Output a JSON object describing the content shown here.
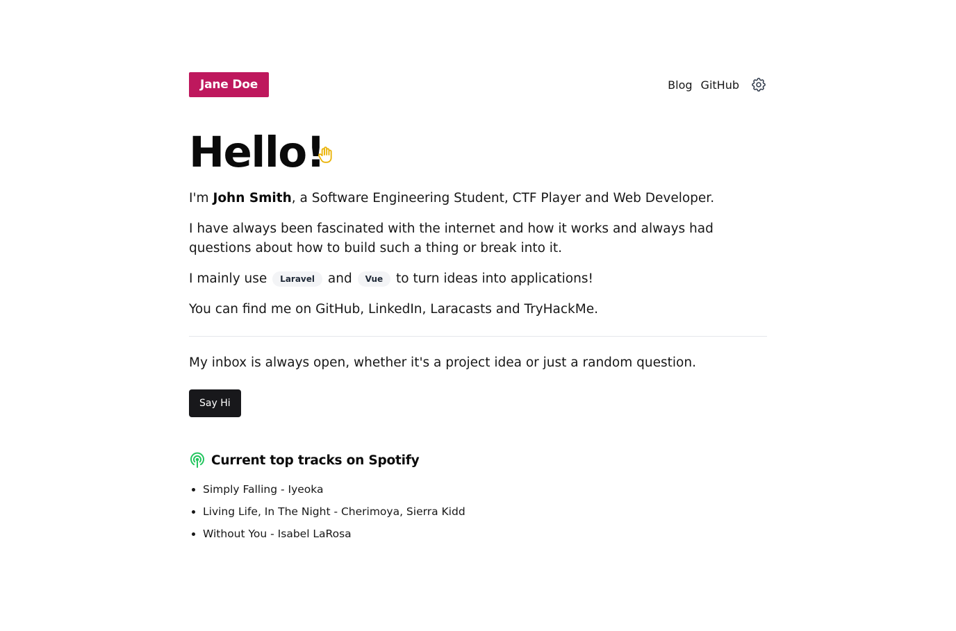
{
  "header": {
    "brand": "Jane Doe",
    "nav": [
      "Blog",
      "GitHub"
    ],
    "settings_icon": "gear-icon"
  },
  "hero": {
    "title": "Hello!",
    "wave_icon": "waving-hand-icon"
  },
  "intro": {
    "prefix": "I'm ",
    "name": "John Smith",
    "suffix": ", a Software Engineering Student, CTF Player and Web Developer.",
    "fascination": "I have always been fascinated with the internet and how it works and always had questions about how to build such a thing or break into it.",
    "tools_prefix": "I mainly use",
    "tool_1": "Laravel",
    "tools_and": "and",
    "tool_2": "Vue",
    "tools_suffix": "to turn ideas into applications!",
    "find_prefix": "You can find me on ",
    "link_github": "GitHub",
    "link_linkedin": "LinkedIn",
    "link_laracasts": "Laracasts",
    "find_and": " and ",
    "link_tryhackme": "TryHackMe",
    "find_suffix": "."
  },
  "contact": {
    "text": "My inbox is always open, whether it's a project idea or just a random question.",
    "button": "Say Hi"
  },
  "spotify": {
    "icon": "podcast-icon",
    "heading": "Current top tracks on Spotify",
    "tracks": [
      "Simply Falling - Iyeoka",
      "Living Life, In The Night - Cherimoya, Sierra Kidd",
      "Without You - Isabel LaRosa"
    ]
  },
  "colors": {
    "brand": "#be185d",
    "button": "#18181b",
    "wave": "#eab308",
    "spotify_icon": "#22c55e",
    "divider": "#e5e7eb"
  }
}
